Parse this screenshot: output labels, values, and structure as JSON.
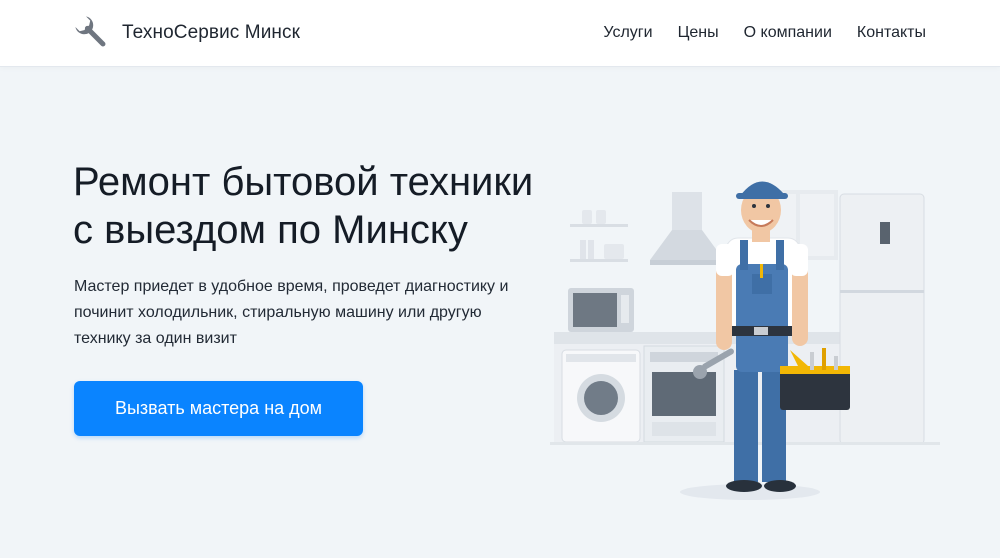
{
  "header": {
    "brand": "ТехноСервис Минск",
    "logo_icon": "wrench-icon",
    "nav": [
      {
        "label": "Услуги"
      },
      {
        "label": "Цены"
      },
      {
        "label": "О компании"
      },
      {
        "label": "Контакты"
      }
    ]
  },
  "hero": {
    "title_line1": "Ремонт бытовой техники",
    "title_line2": "с выездом по Минску",
    "subtitle": "Мастер приедет в удобное время, проведет диагностику и починит холодильник, стиральную машину или другую технику за один визит",
    "cta_label": "Вызвать мастера на дом"
  },
  "colors": {
    "accent": "#0a84ff",
    "background": "#f1f5f8",
    "header": "#ffffff"
  },
  "illustration": {
    "icons": [
      "technician-icon",
      "kitchen-appliances-icon",
      "washing-machine-icon",
      "oven-icon",
      "microwave-icon",
      "refrigerator-icon",
      "range-hood-icon",
      "toolbox-icon",
      "wrench-icon"
    ]
  }
}
